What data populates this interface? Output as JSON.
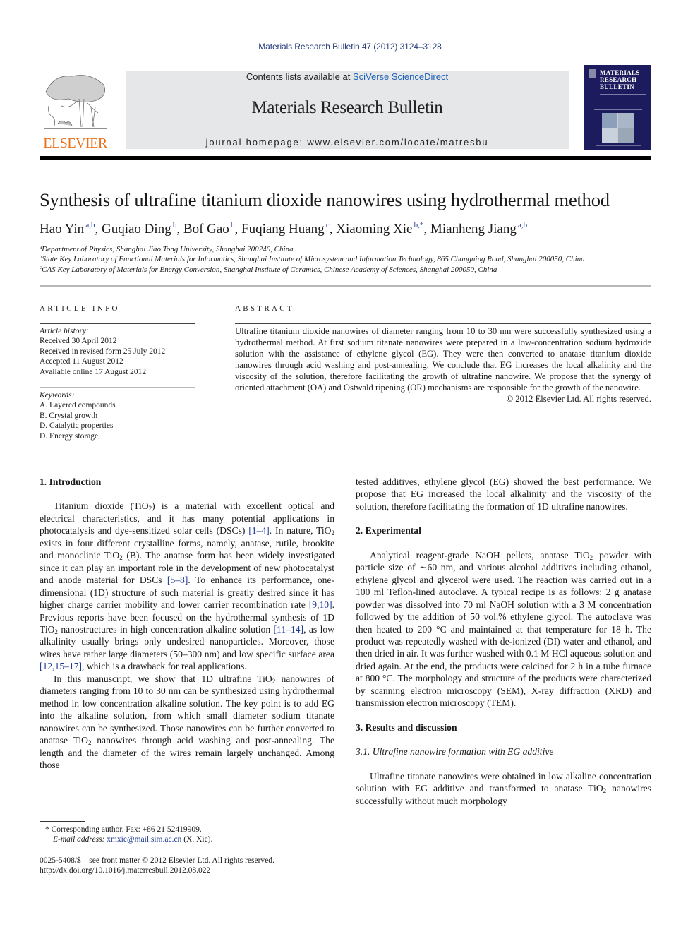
{
  "header": {
    "citation": "Materials Research Bulletin 47 (2012) 3124–3128",
    "contents_prefix": "Contents lists available at ",
    "contents_link": "SciVerse ScienceDirect",
    "journal_name": "Materials Research Bulletin",
    "homepage_line": "journal homepage: www.elsevier.com/locate/matresbu",
    "publisher_logo_text": "ELSEVIER",
    "cover": {
      "title_lines": [
        "MATERIALS",
        "RESEARCH",
        "BULLETIN"
      ]
    },
    "colors": {
      "elsevier_orange": "#e9711c",
      "link_blue": "#1f63b7",
      "cover_navy": "#1c1b5e",
      "banner_gray": "#e6e7e8"
    }
  },
  "article": {
    "title": "Synthesis of ultrafine titanium dioxide nanowires using hydrothermal method",
    "authors": [
      {
        "name": "Hao Yin",
        "sup": "a,b",
        "sep": ", "
      },
      {
        "name": "Guqiao Ding",
        "sup": "b",
        "sep": ", "
      },
      {
        "name": "Bof Gao",
        "sup": "b",
        "sep": ", "
      },
      {
        "name": "Fuqiang Huang",
        "sup": "c",
        "sep": ", "
      },
      {
        "name": "Xiaoming Xie",
        "sup": "b,*",
        "sep": ", "
      },
      {
        "name": "Mianheng Jiang",
        "sup": "a,b",
        "sep": ""
      }
    ],
    "affiliations": [
      {
        "mark": "a",
        "text": "Department of Physics, Shanghai Jiao Tong University, Shanghai 200240, China"
      },
      {
        "mark": "b",
        "text": "State Key Laboratory of Functional Materials for Informatics, Shanghai Institute of Microsystem and Information Technology, 865 Changning Road, Shanghai 200050, China"
      },
      {
        "mark": "c",
        "text": "CAS Key Laboratory of Materials for Energy Conversion, Shanghai Institute of Ceramics, Chinese Academy of Sciences, Shanghai 200050, China"
      }
    ]
  },
  "article_info": {
    "heading": "ARTICLE INFO",
    "history_label": "Article history:",
    "history": [
      "Received 30 April 2012",
      "Received in revised form 25 July 2012",
      "Accepted 11 August 2012",
      "Available online 17 August 2012"
    ],
    "keywords_label": "Keywords:",
    "keywords": [
      "A. Layered compounds",
      "B. Crystal growth",
      "D. Catalytic properties",
      "D. Energy storage"
    ]
  },
  "abstract": {
    "heading": "ABSTRACT",
    "text": "Ultrafine titanium dioxide nanowires of diameter ranging from 10 to 30 nm were successfully synthesized using a hydrothermal method. At first sodium titanate nanowires were prepared in a low-concentration sodium hydroxide solution with the assistance of ethylene glycol (EG). They were then converted to anatase titanium dioxide nanowires through acid washing and post-annealing. We conclude that EG increases the local alkalinity and the viscosity of the solution, therefore facilitating the growth of ultrafine nanowire. We propose that the synergy of oriented attachment (OA) and Ostwald ripening (OR) mechanisms are responsible for the growth of the nanowire.",
    "copyright": "© 2012 Elsevier Ltd. All rights reserved."
  },
  "body": {
    "sec1_heading": "1.  Introduction",
    "sec1_p1": [
      {
        "t": "Titanium dioxide (TiO"
      },
      {
        "sub": "2"
      },
      {
        "t": ") is a material with excellent optical and electrical characteristics, and it has many potential applications in photocatalysis and dye-sensitized solar cells (DSCs) "
      },
      {
        "ref": "[1–4]"
      },
      {
        "t": ". In nature, TiO"
      },
      {
        "sub": "2"
      },
      {
        "t": " exists in four different crystalline forms, namely, anatase, rutile, brookite and monoclinic TiO"
      },
      {
        "sub": "2"
      },
      {
        "t": " (B). The anatase form has been widely investigated since it can play an important role in the development of new photocatalyst and anode material for DSCs "
      },
      {
        "ref": "[5–8]"
      },
      {
        "t": ". To enhance its performance, one-dimensional (1D) structure of such material is greatly desired since it has higher charge carrier mobility and lower carrier recombination rate "
      },
      {
        "ref": "[9,10]"
      },
      {
        "t": ". Previous reports have been focused on the hydrothermal synthesis of 1D TiO"
      },
      {
        "sub": "2"
      },
      {
        "t": " nanostructures in high concentration alkaline solution "
      },
      {
        "ref": "[11–14]"
      },
      {
        "t": ", as low alkalinity usually brings only undesired nanoparticles. Moreover, those wires have rather large diameters (50–300 nm) and low specific surface area "
      },
      {
        "ref": "[12,15–17]"
      },
      {
        "t": ", which is a drawback for real applications."
      }
    ],
    "sec1_p2": [
      {
        "t": "In this manuscript, we show that 1D ultrafine TiO"
      },
      {
        "sub": "2"
      },
      {
        "t": " nanowires of diameters ranging from 10 to 30 nm can be synthesized using hydrothermal method in low concentration alkaline solution. The key point is to add EG into the alkaline solution, from which small diameter sodium titanate nanowires can be synthesized. Those nanowires can be further converted to anatase TiO"
      },
      {
        "sub": "2"
      },
      {
        "t": " nanowires through acid washing and post-annealing. The length and the diameter of the wires remain largely unchanged. Among those"
      }
    ],
    "right_p0": "tested additives, ethylene glycol (EG) showed the best performance. We propose that EG increased the local alkalinity and the viscosity of the solution, therefore facilitating the formation of 1D ultrafine nanowires.",
    "sec2_heading": "2.  Experimental",
    "sec2_p1": [
      {
        "t": "Analytical reagent-grade NaOH pellets, anatase TiO"
      },
      {
        "sub": "2"
      },
      {
        "t": " powder with particle size of ∼60 nm, and various alcohol additives including ethanol, ethylene glycol and glycerol were used. The reaction was carried out in a 100 ml Teflon-lined autoclave. A typical recipe is as follows: 2 g anatase powder was dissolved into 70 ml NaOH solution with a 3 M concentration followed by the addition of 50 vol.% ethylene glycol. The autoclave was then heated to 200 °C and maintained at that temperature for 18 h. The product was repeatedly washed with de-ionized (DI) water and ethanol, and then dried in air. It was further washed with 0.1 M HCl aqueous solution and dried again. At the end, the products were calcined for 2 h in a tube furnace at 800 °C. The morphology and structure of the products were characterized by scanning electron microscopy (SEM), X-ray diffraction (XRD) and transmission electron microscopy (TEM)."
      }
    ],
    "sec3_heading": "3.  Results and discussion",
    "sec31_heading": "3.1.  Ultrafine nanowire formation with EG additive",
    "sec31_p1": [
      {
        "t": "Ultrafine titanate nanowires were obtained in low alkaline concentration solution with EG additive and transformed to anatase TiO"
      },
      {
        "sub": "2"
      },
      {
        "t": " nanowires successfully without much morphology"
      }
    ]
  },
  "footnotes": {
    "corresponding": "* Corresponding author. Fax: +86 21 52419909.",
    "email_label": "E-mail address: ",
    "email": "xmxie@mail.sim.ac.cn",
    "email_suffix": " (X. Xie).",
    "issn_line": "0025-5408/$ – see front matter © 2012 Elsevier Ltd. All rights reserved.",
    "doi": "http://dx.doi.org/10.1016/j.materresbull.2012.08.022"
  }
}
